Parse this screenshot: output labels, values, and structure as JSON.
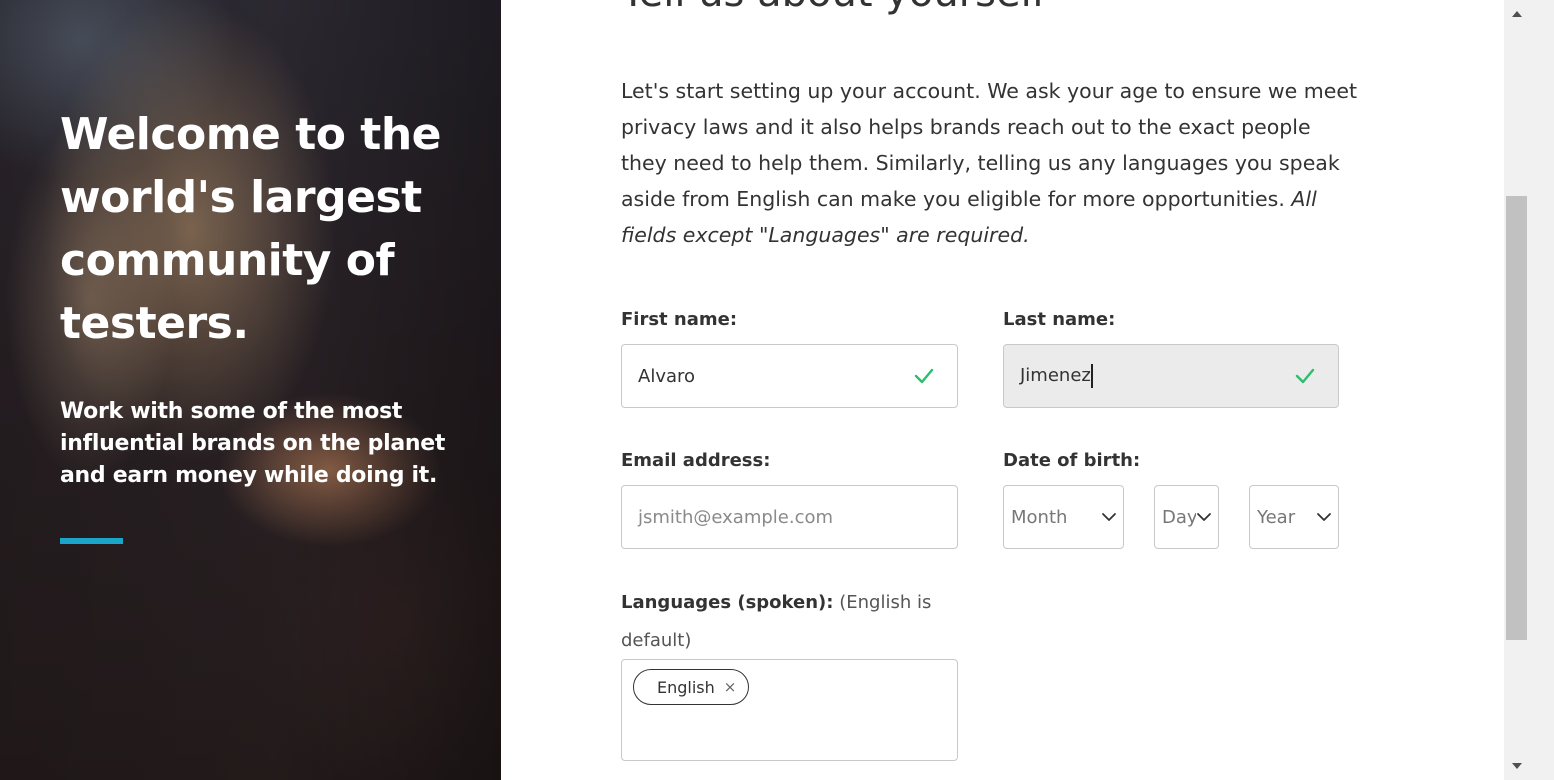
{
  "hero": {
    "title": "Welcome to the world's largest community of testers.",
    "subtitle": "Work with some of the most influential brands on the planet and earn money while doing it.",
    "accent_color": "#1ba6c9"
  },
  "form": {
    "heading": "Tell us about yourself",
    "intro_text": "Let's start setting up your account. We ask your age to ensure we meet privacy laws and it also helps brands reach out to the exact people they need to help them. Similarly, telling us any languages you speak aside from English can make you eligible for more opportunities.",
    "intro_emphasis": "All fields except \"Languages\" are required.",
    "first_name": {
      "label": "First name:",
      "value": "Alvaro",
      "valid_icon": "check-icon"
    },
    "last_name": {
      "label": "Last name:",
      "value": "Jimenez",
      "valid_icon": "check-icon"
    },
    "email": {
      "label": "Email address:",
      "placeholder": "jsmith@example.com"
    },
    "date_of_birth": {
      "label": "Date of birth:",
      "month": "Month",
      "day": "Day",
      "year": "Year"
    },
    "languages": {
      "label": "Languages (spoken):",
      "hint": "(English is default)",
      "tags": [
        {
          "label": "English",
          "remove_symbol": "×"
        }
      ]
    },
    "valid_color": "#2dbd6e"
  },
  "scrollbar": {
    "up_icon": "arrow-up-icon",
    "down_icon": "arrow-down-icon"
  }
}
